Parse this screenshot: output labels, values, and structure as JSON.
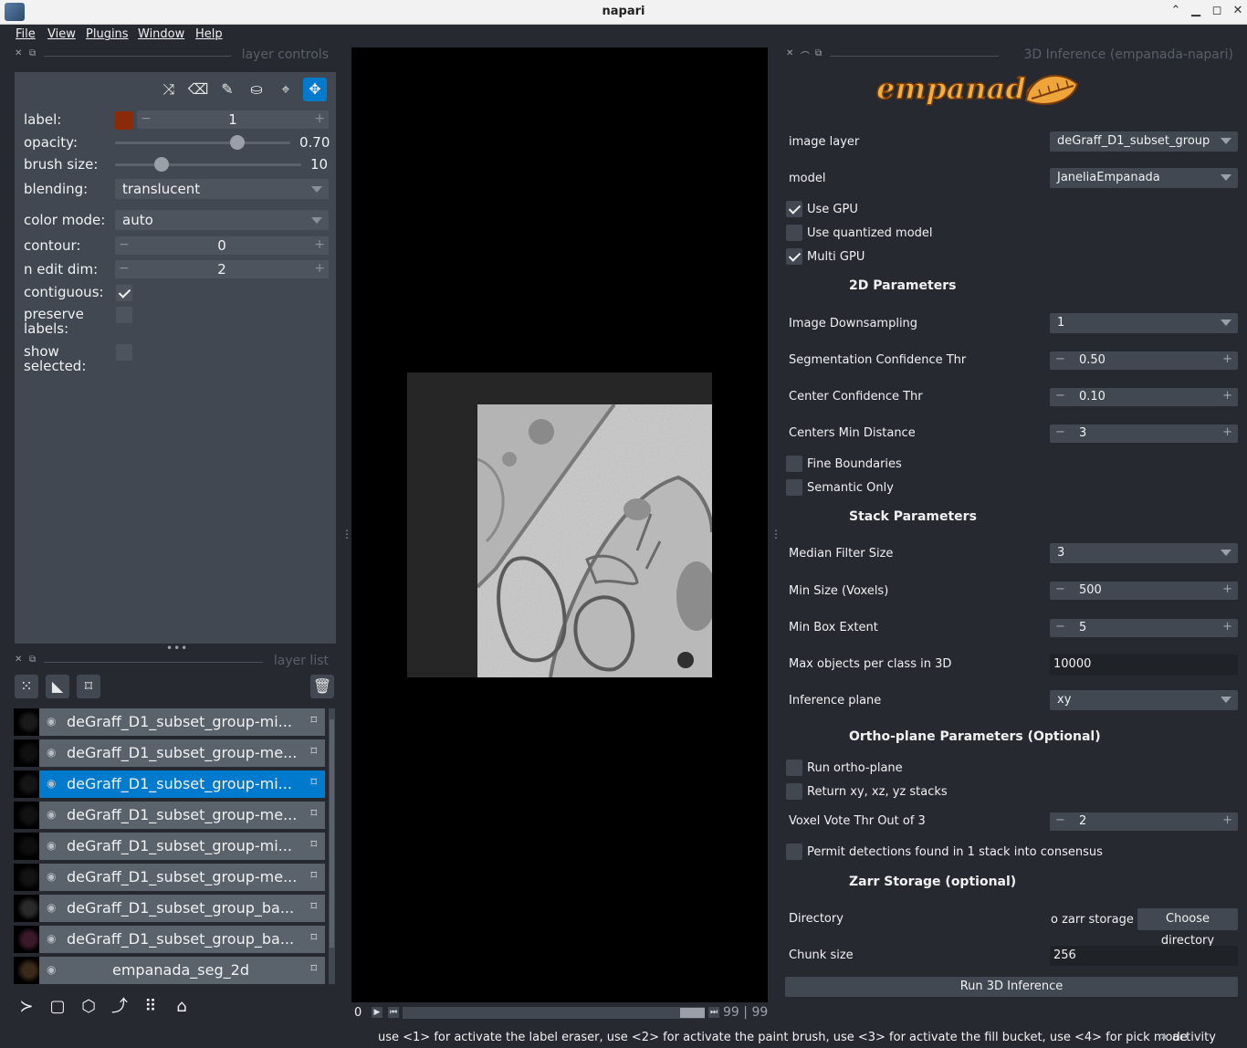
{
  "window": {
    "title": "napari"
  },
  "menu": [
    "File",
    "View",
    "Plugins",
    "Window",
    "Help"
  ],
  "layer_controls": {
    "header": "layer controls",
    "label_label": "label:",
    "label_value": "1",
    "label_color": "#8b2a0a",
    "opacity_label": "opacity:",
    "opacity_value": "0.70",
    "opacity_fraction": 0.7,
    "brush_label": "brush size:",
    "brush_value": "10",
    "brush_fraction": 0.25,
    "blending_label": "blending:",
    "blending_value": "translucent",
    "color_mode_label": "color mode:",
    "color_mode_value": "auto",
    "contour_label": "contour:",
    "contour_value": "0",
    "n_edit_dim_label": "n edit dim:",
    "n_edit_dim_value": "2",
    "contiguous_label": "contiguous:",
    "contiguous_checked": true,
    "preserve_label": "preserve\nlabels:",
    "preserve_checked": false,
    "show_selected_label": "show\nselected:",
    "show_selected_checked": false
  },
  "layer_list": {
    "header": "layer list",
    "layers": [
      {
        "name": "deGraff_D1_subset_group-mi...",
        "selected": false
      },
      {
        "name": "deGraff_D1_subset_group-me...",
        "selected": false
      },
      {
        "name": "deGraff_D1_subset_group-mi...",
        "selected": true
      },
      {
        "name": "deGraff_D1_subset_group-me...",
        "selected": false
      },
      {
        "name": "deGraff_D1_subset_group-mi...",
        "selected": false
      },
      {
        "name": "deGraff_D1_subset_group-me...",
        "selected": false
      },
      {
        "name": "deGraff_D1_subset_group_ba...",
        "selected": false
      },
      {
        "name": "deGraff_D1_subset_group_ba...",
        "selected": false
      },
      {
        "name": "empanada_seg_2d",
        "selected": false
      }
    ]
  },
  "viewer": {
    "slider_start": "0",
    "slider_end_a": "99",
    "slider_sep": "|",
    "slider_end_b": "99"
  },
  "plugin": {
    "header": "3D Inference (empanada-napari)",
    "logo_text": "empanada",
    "image_layer_label": "image layer",
    "image_layer_value": "deGraff_D1_subset_group",
    "model_label": "model",
    "model_value": "JaneliaEmpanada",
    "use_gpu": "Use GPU",
    "use_gpu_checked": true,
    "use_quantized": "Use quantized model",
    "use_quantized_checked": false,
    "multi_gpu": "Multi GPU",
    "multi_gpu_checked": true,
    "section_2d": "2D Parameters",
    "downsampling_label": "Image Downsampling",
    "downsampling_value": "1",
    "seg_conf_label": "Segmentation Confidence Thr",
    "seg_conf_value": "0.50",
    "center_conf_label": "Center Confidence Thr",
    "center_conf_value": "0.10",
    "centers_min_label": "Centers Min Distance",
    "centers_min_value": "3",
    "fine_boundaries": "Fine Boundaries",
    "fine_boundaries_checked": false,
    "semantic_only": "Semantic Only",
    "semantic_only_checked": false,
    "section_stack": "Stack Parameters",
    "median_label": "Median Filter Size",
    "median_value": "3",
    "min_size_label": "Min Size (Voxels)",
    "min_size_value": "500",
    "min_box_label": "Min Box Extent",
    "min_box_value": "5",
    "max_obj_label": "Max objects per class in 3D",
    "max_obj_value": "10000",
    "inference_plane_label": "Inference plane",
    "inference_plane_value": "xy",
    "section_ortho": "Ortho-plane Parameters (Optional)",
    "run_ortho": "Run ortho-plane",
    "run_ortho_checked": false,
    "return_stacks": "Return xy, xz, yz stacks",
    "return_stacks_checked": false,
    "voxel_vote_label": "Voxel Vote Thr Out of 3",
    "voxel_vote_value": "2",
    "permit": "Permit detections found in 1 stack into consensus",
    "permit_checked": false,
    "section_zarr": "Zarr Storage (optional)",
    "directory_label": "Directory",
    "directory_value": "o zarr storage",
    "choose_dir": "Choose directory",
    "chunk_label": "Chunk size",
    "chunk_value": "256",
    "run_button": "Run 3D Inference"
  },
  "status": {
    "message": "use <1> for activate the label eraser, use <2> for activate the paint brush, use <3> for activate the fill bucket, use <4> for pick mode",
    "activity": "activity"
  }
}
